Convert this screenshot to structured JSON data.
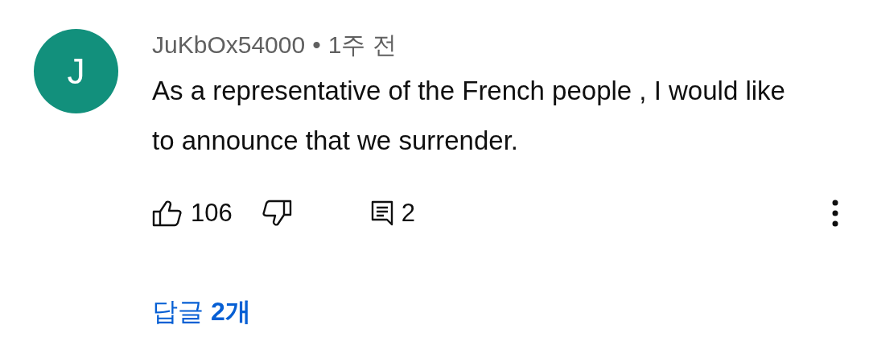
{
  "comment": {
    "avatar": {
      "letter": "J",
      "color": "#12907c"
    },
    "author": "JuKbOx54000",
    "separator": "•",
    "time": "1주 전",
    "text": "As a representative of the French people , I would like to announce that we surrender.",
    "likes": "106",
    "replies_count": "2",
    "replies_link": "답글 **2개**"
  }
}
